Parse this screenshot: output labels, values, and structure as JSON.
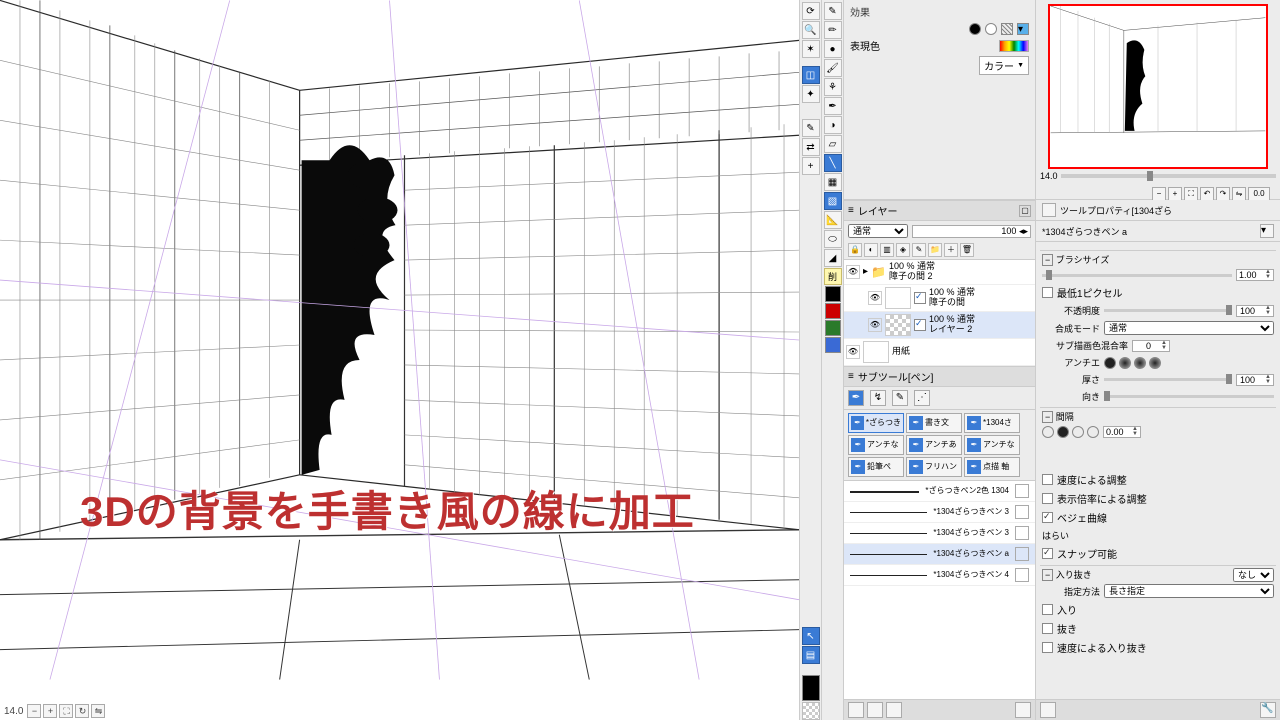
{
  "overlay_title": "3Dの背景を手書き風の線に加工",
  "canvas": {
    "zoom_text": "14.0"
  },
  "effect": {
    "label": "効果",
    "expr_label": "表現色",
    "color_mode": "カラー"
  },
  "navigator": {
    "zoom": "14.0",
    "angle": "0.0"
  },
  "layer": {
    "head": "レイヤー",
    "mode": "通常",
    "opacity": "100",
    "items": [
      {
        "opacity": "100 % 通常",
        "name": "障子の間 2",
        "type": "folder"
      },
      {
        "opacity": "100 % 通常",
        "name": "障子の間",
        "type": "image",
        "indent": true
      },
      {
        "opacity": "100 % 通常",
        "name": "レイヤー 2",
        "type": "checker",
        "indent": true,
        "selected": true
      },
      {
        "opacity": "",
        "name": "用紙",
        "type": "paper"
      }
    ]
  },
  "subtool": {
    "head": "サブツール[ペン]",
    "buttons": [
      {
        "label": "*ざらつき",
        "selected": true
      },
      {
        "label": "書き文"
      },
      {
        "label": "*1304さ"
      },
      {
        "label": "アンチな"
      },
      {
        "label": "アンチあ"
      },
      {
        "label": "アンチな"
      },
      {
        "label": "鉛筆ぺ"
      },
      {
        "label": "フリハン"
      },
      {
        "label": "点描 軸"
      }
    ],
    "strokes": [
      {
        "name": "*ざらつきペン2色 1304"
      },
      {
        "name": "*1304ざらつきペン 3"
      },
      {
        "name": "*1304ざらつきペン 3"
      },
      {
        "name": "*1304ざらつきペン a",
        "selected": true
      },
      {
        "name": "*1304ざらつきペン 4"
      }
    ]
  },
  "prop": {
    "head": "ツールプロパティ[1304ざら",
    "sub": "*1304ざらつきペン a",
    "brush_size_label": "ブラシサイズ",
    "brush_size": "1.00",
    "min1px": "最低1ピクセル",
    "opacity_label": "不透明度",
    "opacity": "100",
    "blend_label": "合成モード",
    "blend": "通常",
    "subcolor_label": "サブ描画色混合率",
    "subcolor": "0",
    "alias_label": "アンチエ",
    "thickness_label": "厚さ",
    "thickness": "100",
    "direction_label": "向き",
    "spacing_label": "間隔",
    "spacing": "0.00",
    "checks": {
      "speed": "速度による調整",
      "zoom": "表示倍率による調整",
      "bezier": "ベジェ曲線",
      "bezier_on": true
    },
    "brush_tip_label": "はらい",
    "snap": "スナップ可能",
    "snap_on": true,
    "inout_label": "入り抜き",
    "inout_method_label": "指定方法",
    "inout_mode": "なし",
    "inout_method": "長さ指定",
    "in_label": "入り",
    "out_label": "抜き",
    "speed_inout": "速度による入り抜き"
  },
  "erase_label": "削"
}
